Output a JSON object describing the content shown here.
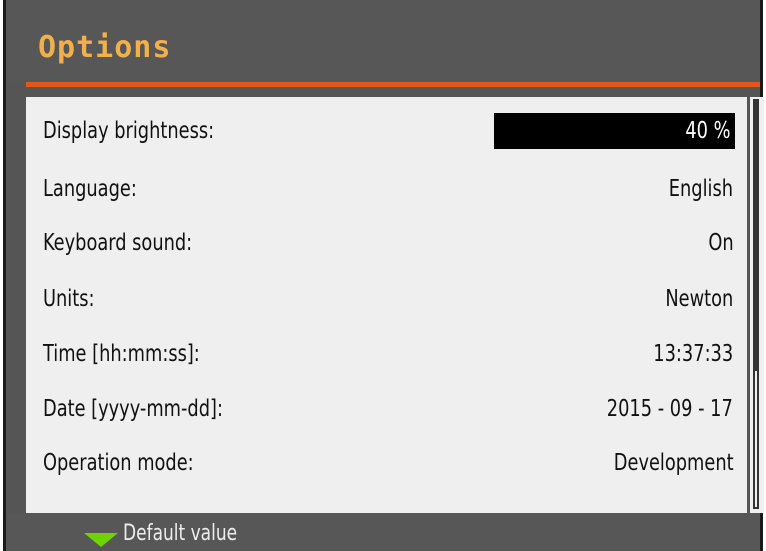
{
  "header": {
    "title": "Options"
  },
  "options": [
    {
      "label": "Display brightness:",
      "value": "40 %"
    },
    {
      "label": "Language:",
      "value": "English"
    },
    {
      "label": "Keyboard sound:",
      "value": "On"
    },
    {
      "label": "Units:",
      "value": "Newton"
    },
    {
      "label": "Time [hh:mm:ss]:",
      "value": "13:37:33"
    },
    {
      "label": "Date [yyyy-mm-dd]:",
      "value": "2015 - 09 - 17"
    },
    {
      "label": "Operation mode:",
      "value": "Development"
    }
  ],
  "footer": {
    "hint_icon": "triangle-down-icon",
    "hint_label": "Default value"
  },
  "colors": {
    "title": "#f2b04a",
    "accent": "#e4571b",
    "panel": "#efefef",
    "frame": "#575757",
    "hint": "#6dd400"
  }
}
